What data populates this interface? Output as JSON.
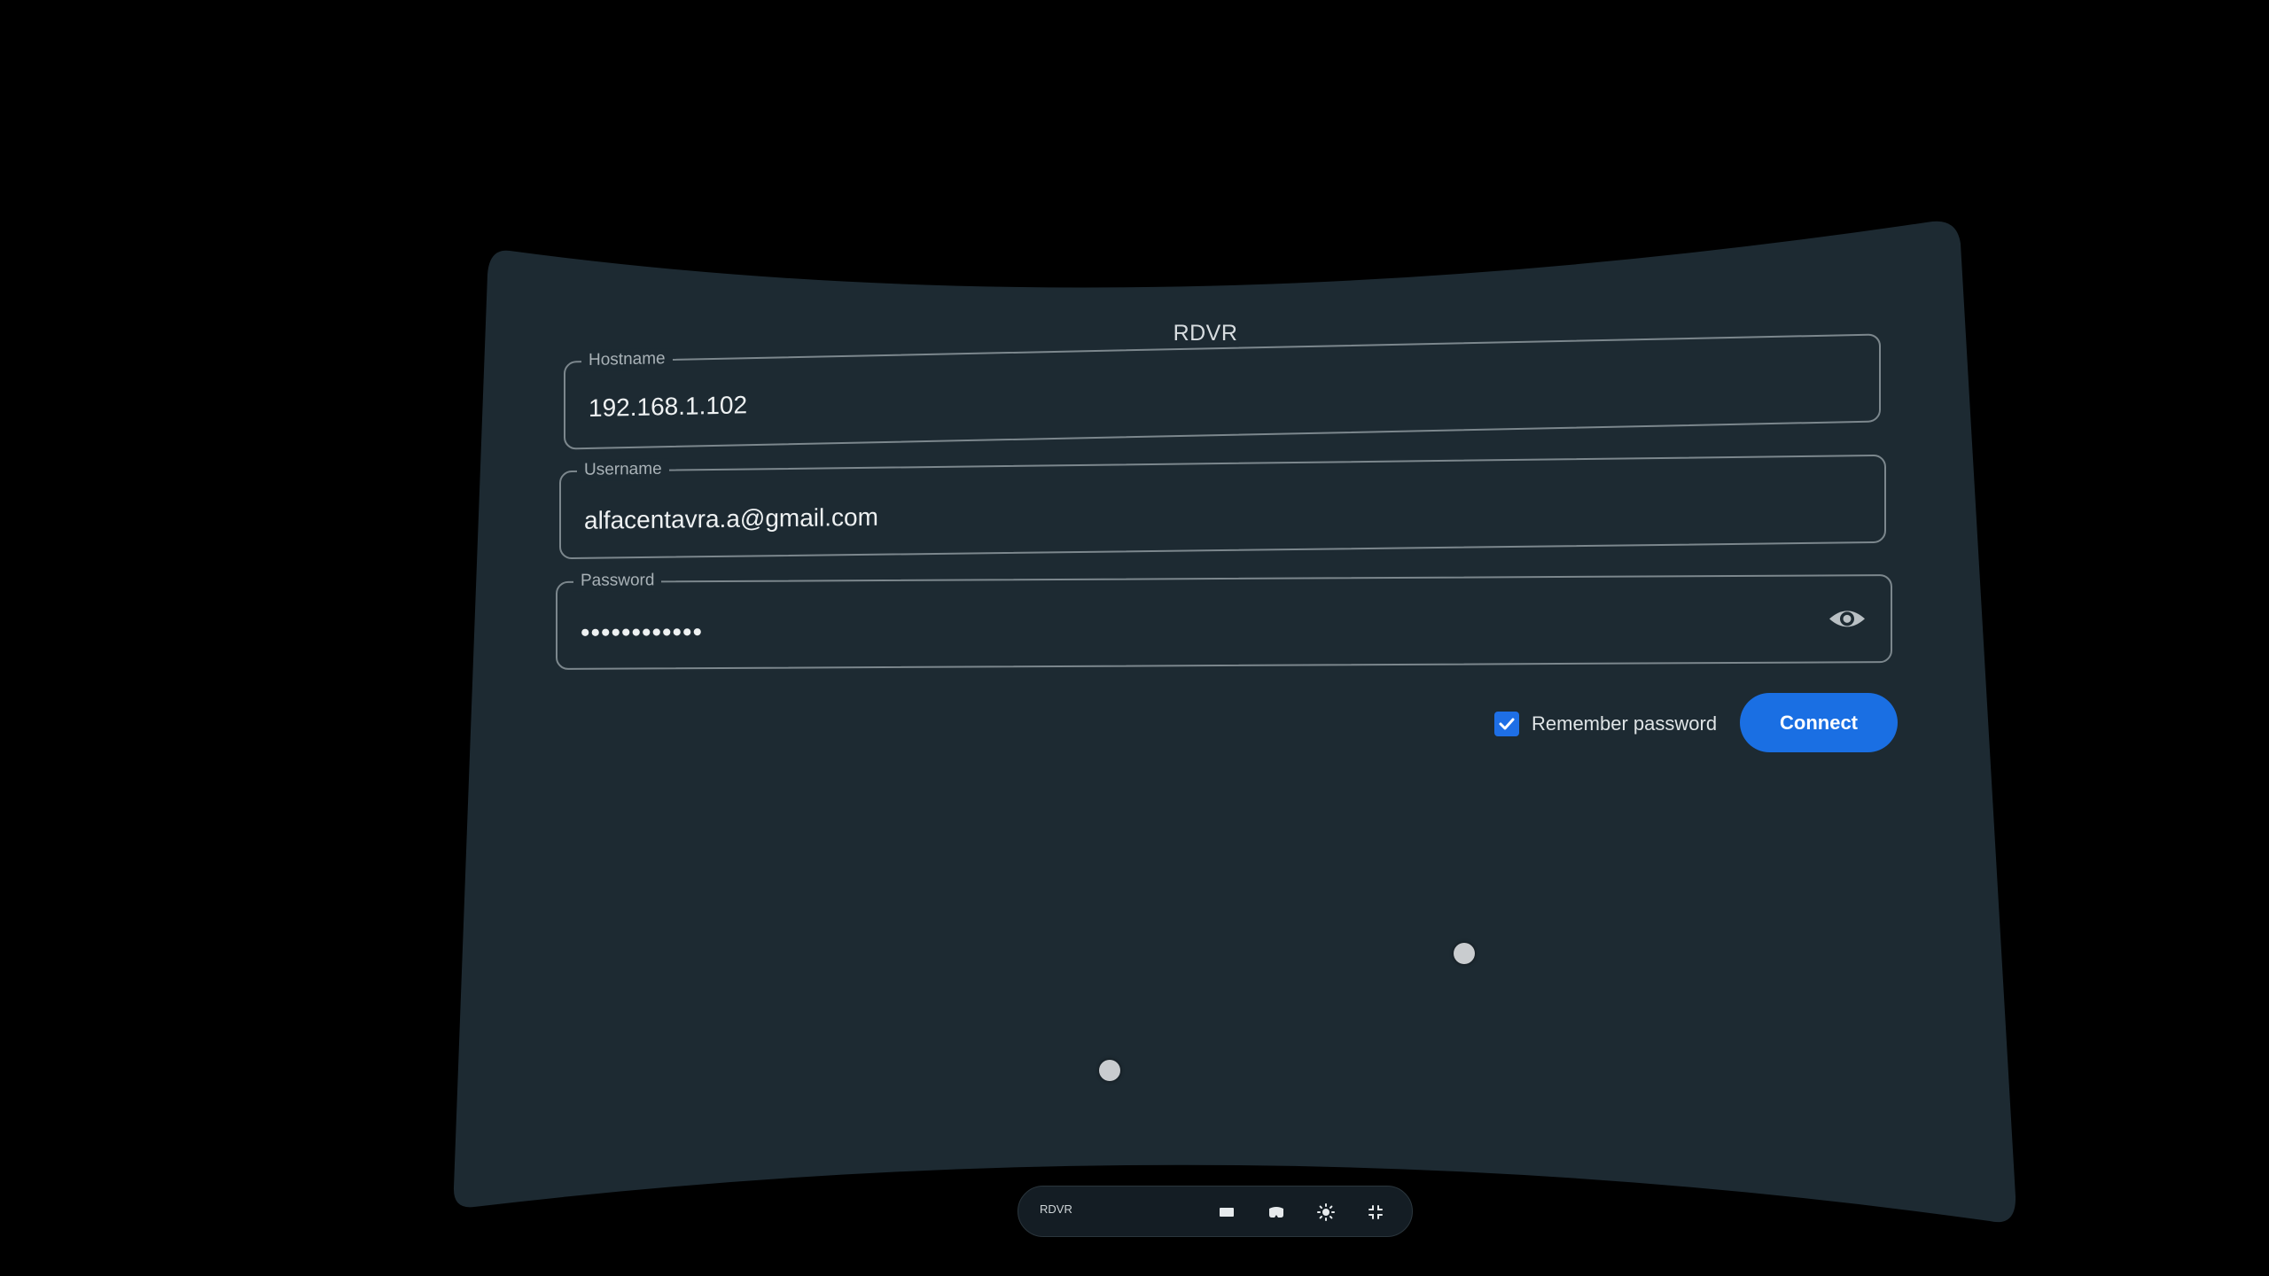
{
  "app": {
    "title": "RDVR"
  },
  "form": {
    "hostname": {
      "label": "Hostname",
      "value": "192.168.1.102"
    },
    "username": {
      "label": "Username",
      "value": "alfacentavra.a@gmail.com"
    },
    "password": {
      "label": "Password",
      "value": "••••••••••••"
    },
    "remember_password": {
      "label": "Remember password",
      "checked": true
    },
    "connect_label": "Connect"
  },
  "taskbar": {
    "title": "RDVR",
    "icons": [
      "screen-icon",
      "headset-icon",
      "brightness-icon",
      "fullscreen-icon"
    ]
  },
  "colors": {
    "background": "#000000",
    "panel": "#1d2a32",
    "accent": "#1a6fe3",
    "field_border": "#7c878d"
  },
  "icons": {
    "password_toggle": "eye-icon",
    "checkbox": "checkmark-icon"
  }
}
